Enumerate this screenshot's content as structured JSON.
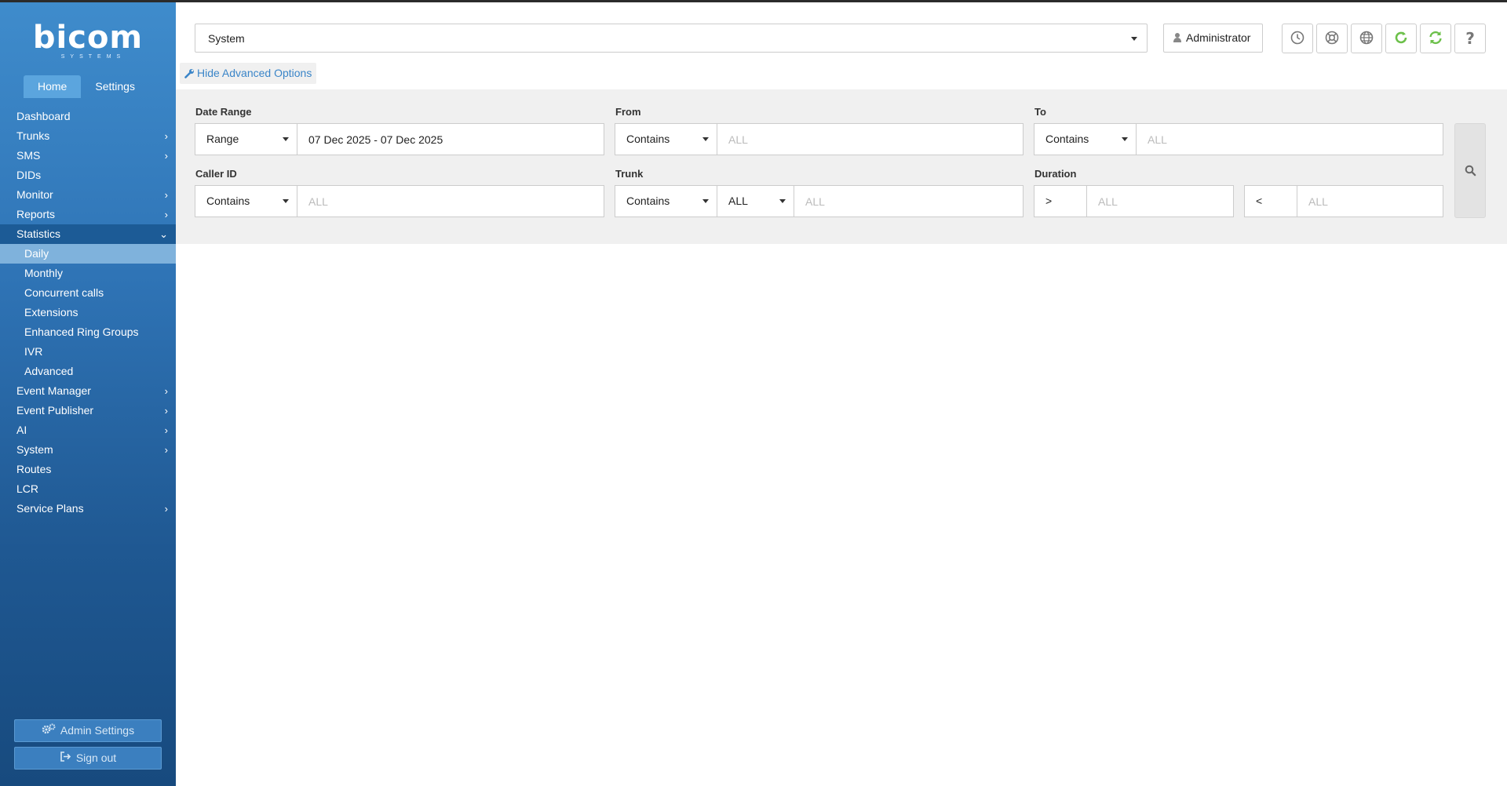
{
  "brand": {
    "logo": "bicom",
    "logo_sub": "SYSTEMS"
  },
  "sidebar": {
    "tabs": [
      {
        "label": "Home",
        "active": true
      },
      {
        "label": "Settings",
        "active": false
      }
    ],
    "menu": [
      {
        "label": "Dashboard"
      },
      {
        "label": "Trunks"
      },
      {
        "label": "SMS"
      },
      {
        "label": "DIDs"
      },
      {
        "label": "Monitor"
      },
      {
        "label": "Reports"
      },
      {
        "label": "Statistics"
      },
      {
        "label": "Daily"
      },
      {
        "label": "Monthly"
      },
      {
        "label": "Concurrent calls"
      },
      {
        "label": "Extensions"
      },
      {
        "label": "Enhanced Ring Groups"
      },
      {
        "label": "IVR"
      },
      {
        "label": "Advanced"
      },
      {
        "label": "Event Manager"
      },
      {
        "label": "Event Publisher"
      },
      {
        "label": "AI"
      },
      {
        "label": "System"
      },
      {
        "label": "Routes"
      },
      {
        "label": "LCR"
      },
      {
        "label": "Service Plans"
      }
    ],
    "admin_settings": "Admin Settings",
    "sign_out": "Sign out"
  },
  "header": {
    "tenant_select": "System",
    "user_label": "Administrator",
    "icons": [
      "clock-icon",
      "support-icon",
      "globe-icon",
      "refresh-icon",
      "sync-icon",
      "help-icon"
    ],
    "accent_green": "#6cc04a"
  },
  "advanced_toggle": "Hide Advanced Options",
  "filters": {
    "date_range": {
      "label": "Date Range",
      "mode": "Range",
      "value": "07 Dec 2025 - 07 Dec 2025"
    },
    "from": {
      "label": "From",
      "mode": "Contains",
      "placeholder": "ALL"
    },
    "to": {
      "label": "To",
      "mode": "Contains",
      "placeholder": "ALL"
    },
    "caller_id": {
      "label": "Caller ID",
      "mode": "Contains",
      "placeholder": "ALL"
    },
    "trunk": {
      "label": "Trunk",
      "mode": "Contains",
      "trunk_select": "ALL",
      "placeholder": "ALL"
    },
    "duration": {
      "label": "Duration",
      "gt_op": ">",
      "gt_placeholder": "ALL",
      "lt_op": "<",
      "lt_placeholder": "ALL"
    }
  },
  "colors": {
    "sidebar_top": "#3f8ccc",
    "sidebar_bottom": "#174a7e",
    "link": "#3a85c8",
    "panel": "#f0f0f0"
  }
}
